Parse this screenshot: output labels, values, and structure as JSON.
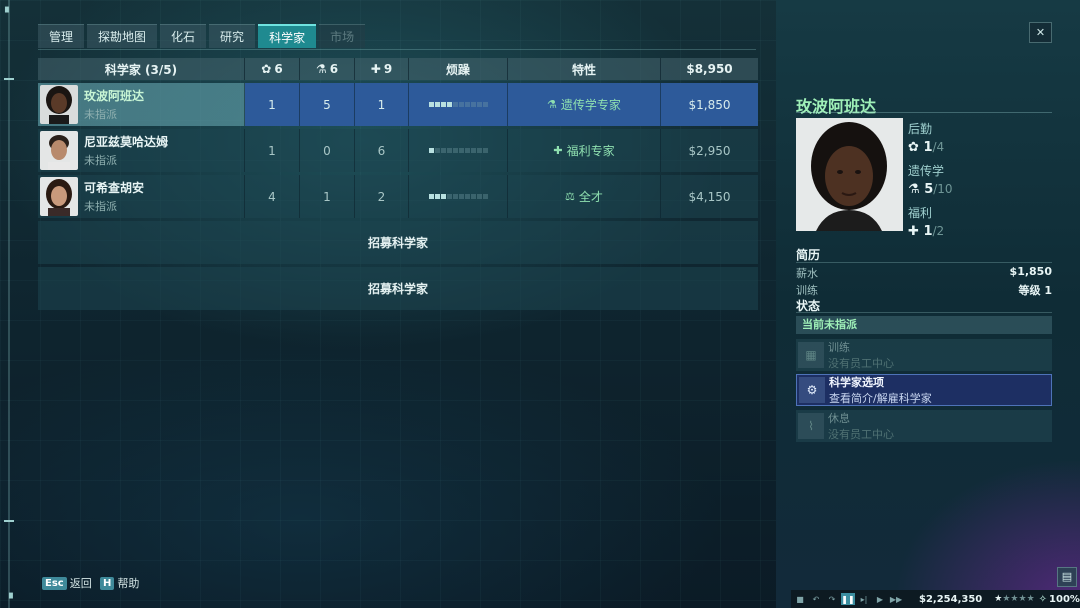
{
  "tabs": [
    {
      "label": "管理"
    },
    {
      "label": "探勘地图"
    },
    {
      "label": "化石"
    },
    {
      "label": "研究"
    },
    {
      "label": "科学家"
    },
    {
      "label": "市场"
    }
  ],
  "table": {
    "headers": {
      "name": "科学家 (3/5)",
      "stat1": "6",
      "stat2": "6",
      "stat3": "9",
      "boredom": "烦躁",
      "trait": "特性",
      "salary": "$8,950"
    },
    "rows": [
      {
        "name": "玫波阿班达",
        "status": "未指派",
        "s1": "1",
        "s2": "5",
        "s3": "1",
        "boredom": 4,
        "trait": "遗传学专家",
        "salary": "$1,850"
      },
      {
        "name": "尼亚兹莫哈达姆",
        "status": "未指派",
        "s1": "1",
        "s2": "0",
        "s3": "6",
        "boredom": 1,
        "trait": "福利专家",
        "salary": "$2,950"
      },
      {
        "name": "可希查胡安",
        "status": "未指派",
        "s1": "4",
        "s2": "1",
        "s3": "2",
        "boredom": 3,
        "trait": "全才",
        "salary": "$4,150"
      }
    ],
    "recruit_label": "招募科学家",
    "boredom_max": 10
  },
  "detail": {
    "name": "玫波阿班达",
    "logistics_label": "后勤",
    "logistics_val": "1",
    "logistics_max": "/4",
    "genetics_label": "遗传学",
    "genetics_val": "5",
    "genetics_max": "/10",
    "welfare_label": "福利",
    "welfare_val": "1",
    "welfare_max": "/2",
    "resume_title": "简历",
    "salary_label": "薪水",
    "salary_val": "$1,850",
    "training_label": "训练",
    "training_val": "等级 1",
    "state_title": "状态",
    "current_status": "当前未指派",
    "actions": [
      {
        "title": "训练",
        "sub": "没有员工中心"
      },
      {
        "title": "科学家选项",
        "sub": "查看简介/解雇科学家"
      },
      {
        "title": "休息",
        "sub": "没有员工中心"
      }
    ]
  },
  "footer": {
    "back_key": "Esc",
    "back_label": "返回",
    "help_key": "H",
    "help_label": "帮助"
  },
  "bottombar": {
    "money": "$2,254,350",
    "rating": 1,
    "rating_max": 5,
    "speed": "100%"
  },
  "colors": {
    "accent": "#1f8a90",
    "selected_row": "#2d5a9a",
    "trait_green": "#8fe0b0",
    "name_green": "#9ff0b8"
  }
}
